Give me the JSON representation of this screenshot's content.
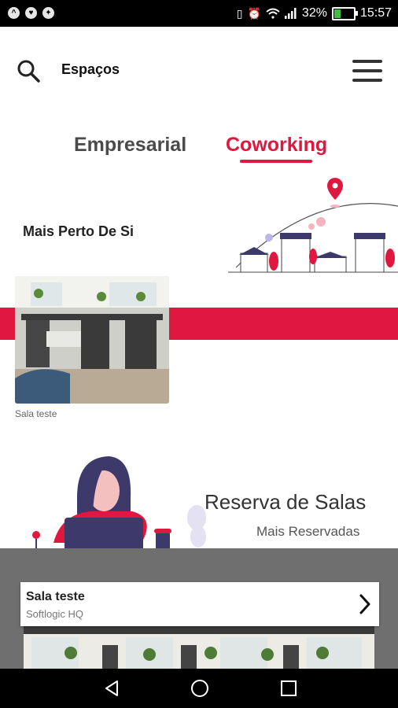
{
  "status_bar": {
    "notification_icons": [
      "app-notification-icon",
      "heart-notification-icon",
      "messenger-notification-icon"
    ],
    "battery_percent": "32%",
    "battery_level": 0.32,
    "time": "15:57"
  },
  "header": {
    "title": "Espaços",
    "search_icon": "search-icon",
    "menu_icon": "hamburger-menu-icon"
  },
  "tabs": [
    {
      "label": "Empresarial",
      "active": false
    },
    {
      "label": "Coworking",
      "active": true
    }
  ],
  "near_section": {
    "title": "Mais Perto De Si",
    "card_caption": "Sala teste"
  },
  "booking_section": {
    "title": "Reserva de Salas",
    "subtitle": "Mais Reservadas",
    "result": {
      "name": "Sala teste",
      "location": "Softlogic HQ"
    }
  },
  "colors": {
    "accent": "#e0173e",
    "gray_band": "#6f6f6f",
    "tab_inactive": "#4a4a4a"
  },
  "nav_bar": {
    "icons": [
      "back-icon",
      "home-icon",
      "recents-icon"
    ]
  }
}
